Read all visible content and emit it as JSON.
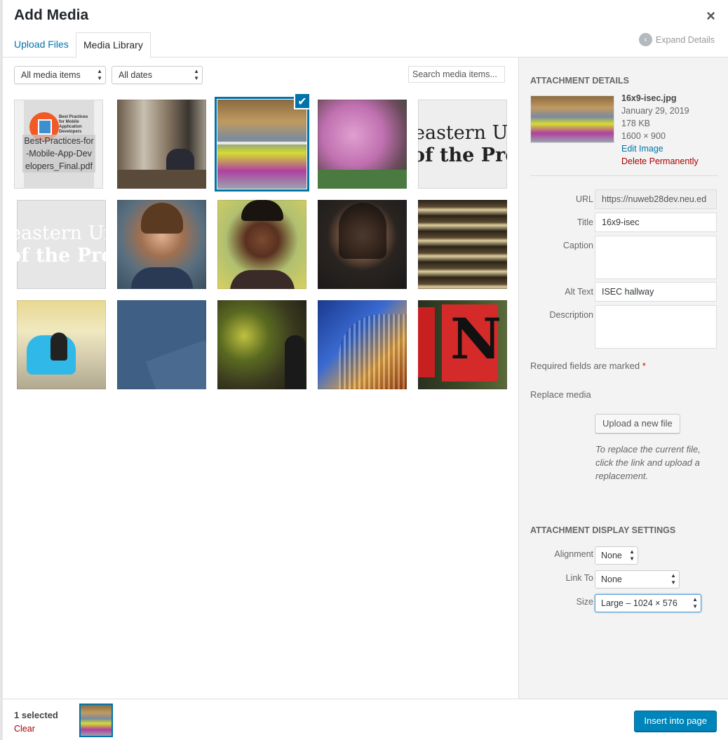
{
  "modal": {
    "title": "Add Media",
    "close_glyph": "×"
  },
  "tabs": [
    {
      "label": "Upload Files"
    },
    {
      "label": "Media Library"
    }
  ],
  "expand_details": {
    "label": "Expand Details",
    "icon": "chevron-left-icon"
  },
  "filters": {
    "type_value": "All media items",
    "date_value": "All dates",
    "search_placeholder": "Search media items..."
  },
  "media_items": [
    {
      "kind": "document",
      "filename": "Best-Practices-for-Mobile-App-Developers_Final.pdf",
      "doc_title": "Best Practices for Mobile Application Developers"
    },
    {
      "kind": "photo",
      "subject": "people at laptops in office"
    },
    {
      "kind": "photo",
      "subject": "ISEC hallway",
      "selected": true
    },
    {
      "kind": "photo",
      "subject": "pink blossom tree"
    },
    {
      "kind": "graphic",
      "text_lines": [
        "eastern Un",
        "of the Prov"
      ]
    },
    {
      "kind": "graphic",
      "text_lines": [
        "eastern Un",
        "of the Prov"
      ],
      "faded": true
    },
    {
      "kind": "photo",
      "subject": "young man portrait"
    },
    {
      "kind": "photo",
      "subject": "woman portrait"
    },
    {
      "kind": "photo",
      "subject": "woman portrait dark background"
    },
    {
      "kind": "photo",
      "subject": "building atrium lights"
    },
    {
      "kind": "photo",
      "subject": "person in blue chair"
    },
    {
      "kind": "graphic",
      "subject": "blue geometric"
    },
    {
      "kind": "photo",
      "subject": "blurred green"
    },
    {
      "kind": "photo",
      "subject": "curved building facade"
    },
    {
      "kind": "photo",
      "subject": "red N banners"
    }
  ],
  "details": {
    "heading": "Attachment Details",
    "filename": "16x9-isec.jpg",
    "date": "January 29, 2019",
    "size": "178 KB",
    "dimensions": "1600 × 900",
    "edit_link": "Edit Image",
    "delete_link": "Delete Permanently",
    "fields": {
      "url_label": "URL",
      "url_value": "https://nuweb28dev.neu.ed",
      "title_label": "Title",
      "title_value": "16x9-isec",
      "caption_label": "Caption",
      "alt_label": "Alt Text",
      "alt_value": "ISEC hallway",
      "description_label": "Description"
    },
    "required_note": "Required fields are marked",
    "required_mark": "*",
    "replace_heading": "Replace media",
    "upload_button": "Upload a new file",
    "replace_note": "To replace the current file, click the link and upload a replacement."
  },
  "display_settings": {
    "heading": "Attachment Display Settings",
    "alignment_label": "Alignment",
    "alignment_value": "None",
    "linkto_label": "Link To",
    "linkto_value": "None",
    "size_label": "Size",
    "size_value": "Large – 1024 × 576"
  },
  "footer": {
    "selected_count": "1 selected",
    "clear_label": "Clear",
    "insert_button": "Insert into page"
  },
  "colors": {
    "accent": "#0073aa",
    "insert_button": "#0085ba",
    "danger": "#a00"
  }
}
